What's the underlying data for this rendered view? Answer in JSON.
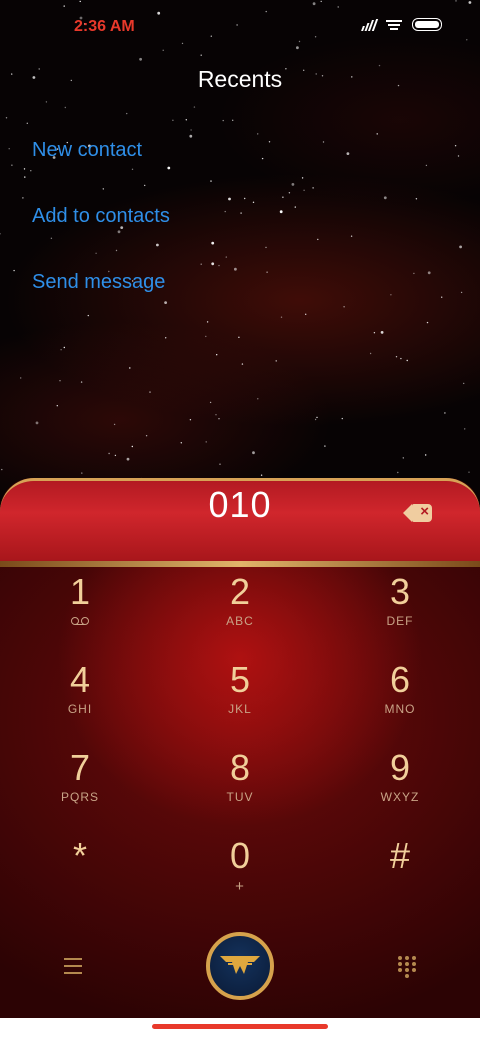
{
  "status_bar": {
    "time": "2:36 AM"
  },
  "header": {
    "title": "Recents"
  },
  "menu": {
    "items": [
      {
        "label": "New contact"
      },
      {
        "label": "Add to contacts"
      },
      {
        "label": "Send message"
      }
    ]
  },
  "dialer": {
    "number": "010",
    "keys": [
      {
        "digit": "1",
        "letters": ""
      },
      {
        "digit": "2",
        "letters": "ABC"
      },
      {
        "digit": "3",
        "letters": "DEF"
      },
      {
        "digit": "4",
        "letters": "GHI"
      },
      {
        "digit": "5",
        "letters": "JKL"
      },
      {
        "digit": "6",
        "letters": "MNO"
      },
      {
        "digit": "7",
        "letters": "PQRS"
      },
      {
        "digit": "8",
        "letters": "TUV"
      },
      {
        "digit": "9",
        "letters": "WXYZ"
      },
      {
        "digit": "*",
        "letters": ""
      },
      {
        "digit": "0",
        "letters": "+"
      },
      {
        "digit": "#",
        "letters": ""
      }
    ]
  },
  "icons": {
    "backspace": "backspace-icon",
    "voicemail": "voicemail-icon",
    "menu": "menu-icon",
    "call": "call-icon",
    "dialpad": "dialpad-icon"
  },
  "colors": {
    "accent_link": "#2f8fe8",
    "status_time": "#e8392b",
    "dialer_red": "#b31a22",
    "gold": "#d6a24c",
    "digit": "#f1cf9a"
  }
}
